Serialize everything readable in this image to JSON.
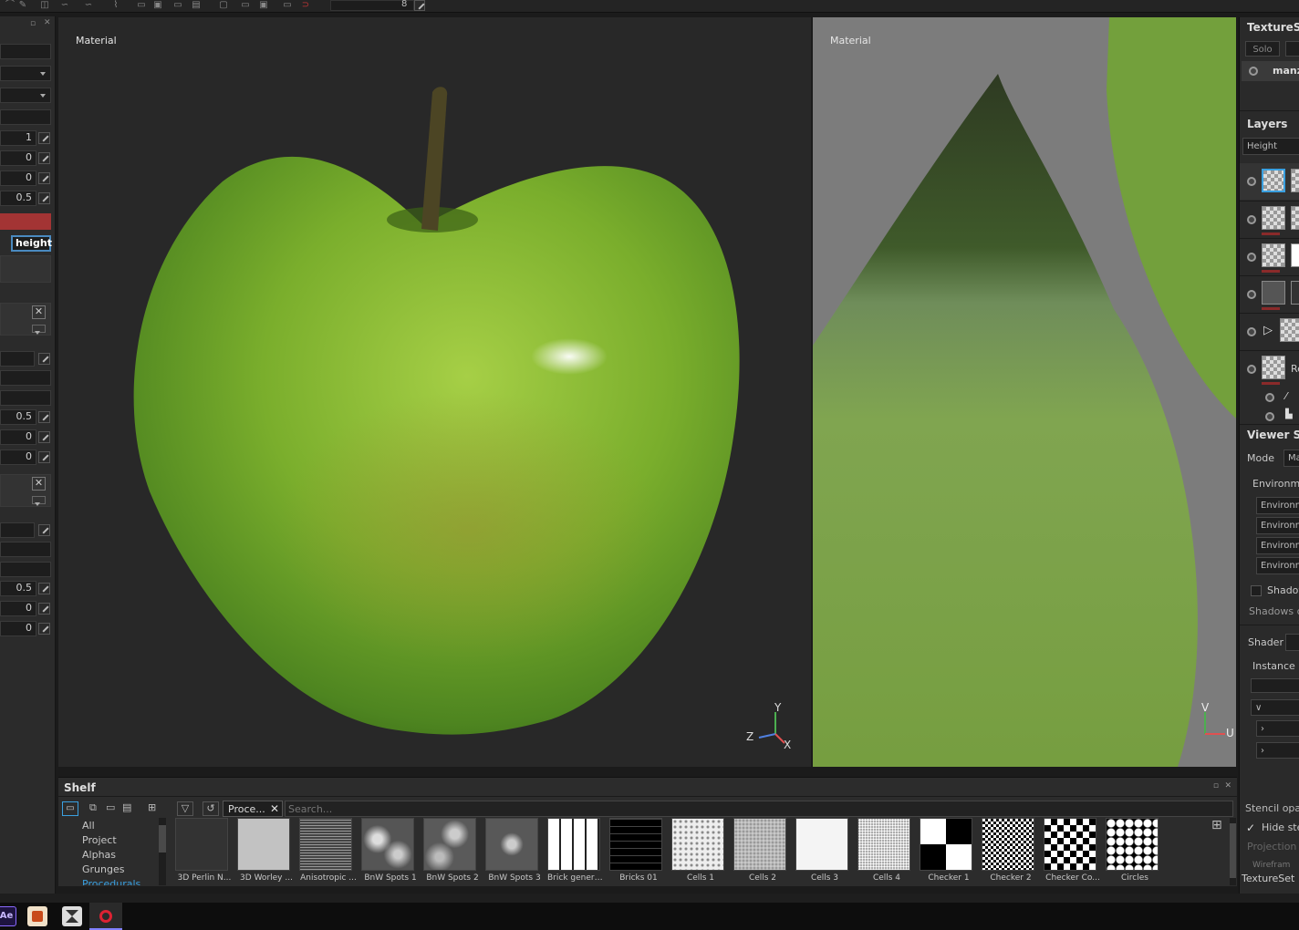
{
  "toolbar": {
    "brush_size": "8"
  },
  "left_panel": {
    "values": [
      "1",
      "0",
      "0",
      "0.5",
      "0.5",
      "0",
      "0",
      "0.5",
      "0",
      "0"
    ],
    "channel_field": "height",
    "remove_glyph": "✕"
  },
  "viewport_3d": {
    "label": "Material",
    "axis_x": "X",
    "axis_y": "Y",
    "axis_z": "Z"
  },
  "viewport_2d": {
    "label": "Material",
    "axis_u": "U",
    "axis_v": "V"
  },
  "right_panel": {
    "texture_set_title": "TextureSe",
    "solo_label": "Solo",
    "texture_set_name": "manz",
    "layers_title": "Layers",
    "channel_dropdown": "Height",
    "layer_partial_label": "Re",
    "viewer_settings_title": "Viewer Set",
    "mode_label": "Mode",
    "mode_value": "Ma",
    "environment_label": "Environme",
    "environment_fields": [
      "Environm",
      "Environm",
      "Environm",
      "Environm"
    ],
    "shadows_label": "Shadov",
    "shadows_computation_label": "Shadows c",
    "shader_label": "Shader",
    "instance_label": "Instance n",
    "stencil_label": "Stencil opac",
    "hide_stencil_label": "Hide ster",
    "projection_label": "Projection p",
    "wireframe_label": "Wirefram",
    "bottom_tab": "TextureSet"
  },
  "shelf": {
    "title": "Shelf",
    "filter_tag": "Proce...",
    "search_placeholder": "Search...",
    "categories": [
      "All",
      "Project",
      "Alphas",
      "Grunges",
      "Procedurals"
    ],
    "active_category": "Procedurals",
    "items": [
      "3D Perlin N...",
      "3D Worley ...",
      "Anisotropic ...",
      "BnW Spots 1",
      "BnW Spots 2",
      "BnW Spots 3",
      "Brick genera...",
      "Bricks 01",
      "Cells 1",
      "Cells 2",
      "Cells 3",
      "Cells 4",
      "Checker 1",
      "Checker 2",
      "Checker Co...",
      "Circles"
    ]
  },
  "taskbar": {
    "ae_label": "Ae"
  },
  "colors": {
    "accent": "#3aa0e0",
    "red_field": "#a33434",
    "apple_green": "#6ea52a"
  }
}
